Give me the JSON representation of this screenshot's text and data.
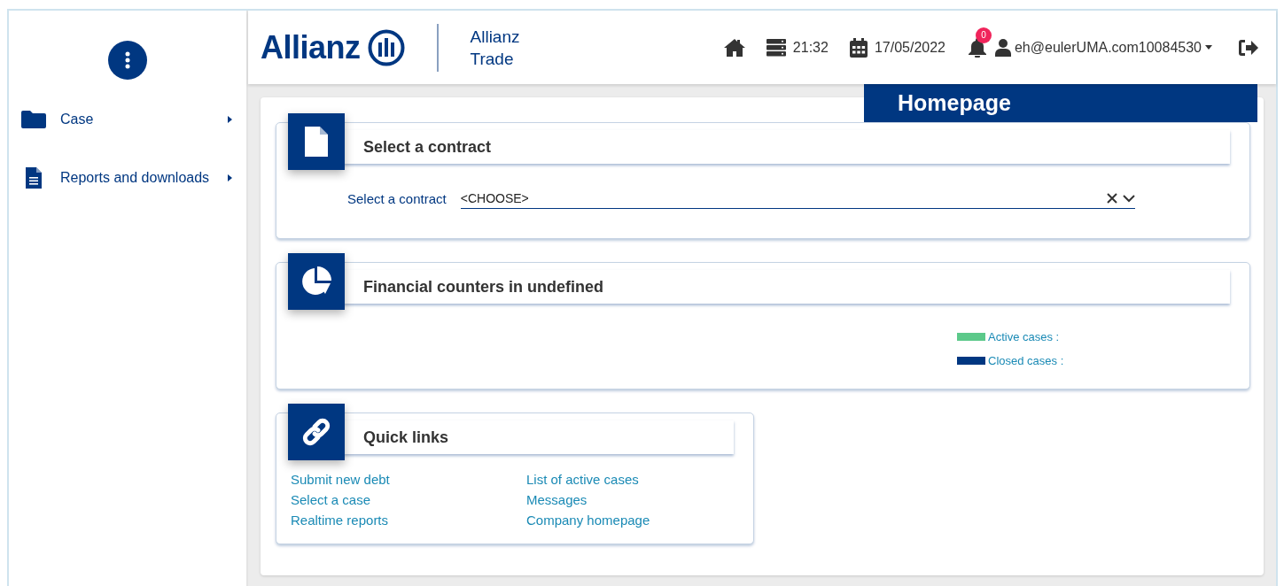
{
  "sidebar": {
    "items": [
      {
        "label": "Case",
        "kind": "folder"
      },
      {
        "label": "Reports and downloads",
        "kind": "document"
      }
    ]
  },
  "header": {
    "brand": "Allianz",
    "subbrand": "Allianz Trade",
    "time": "21:32",
    "date": "17/05/2022",
    "notifications": "0",
    "user": "eh@eulerUMA.com10084530"
  },
  "page_title": "Homepage",
  "contract": {
    "title": "Select a contract",
    "label": "Select a contract",
    "value": "<CHOOSE>"
  },
  "financial": {
    "title": "Financial counters in undefined",
    "legend": [
      {
        "label": "Active cases :",
        "color": "#5cc98a"
      },
      {
        "label": "Closed cases :",
        "color": "#003781"
      }
    ]
  },
  "quick_links": {
    "title": "Quick links",
    "links": [
      "Submit new debt",
      "List of active cases",
      "Select a case",
      "Messages",
      "Realtime reports",
      "Company homepage"
    ]
  }
}
